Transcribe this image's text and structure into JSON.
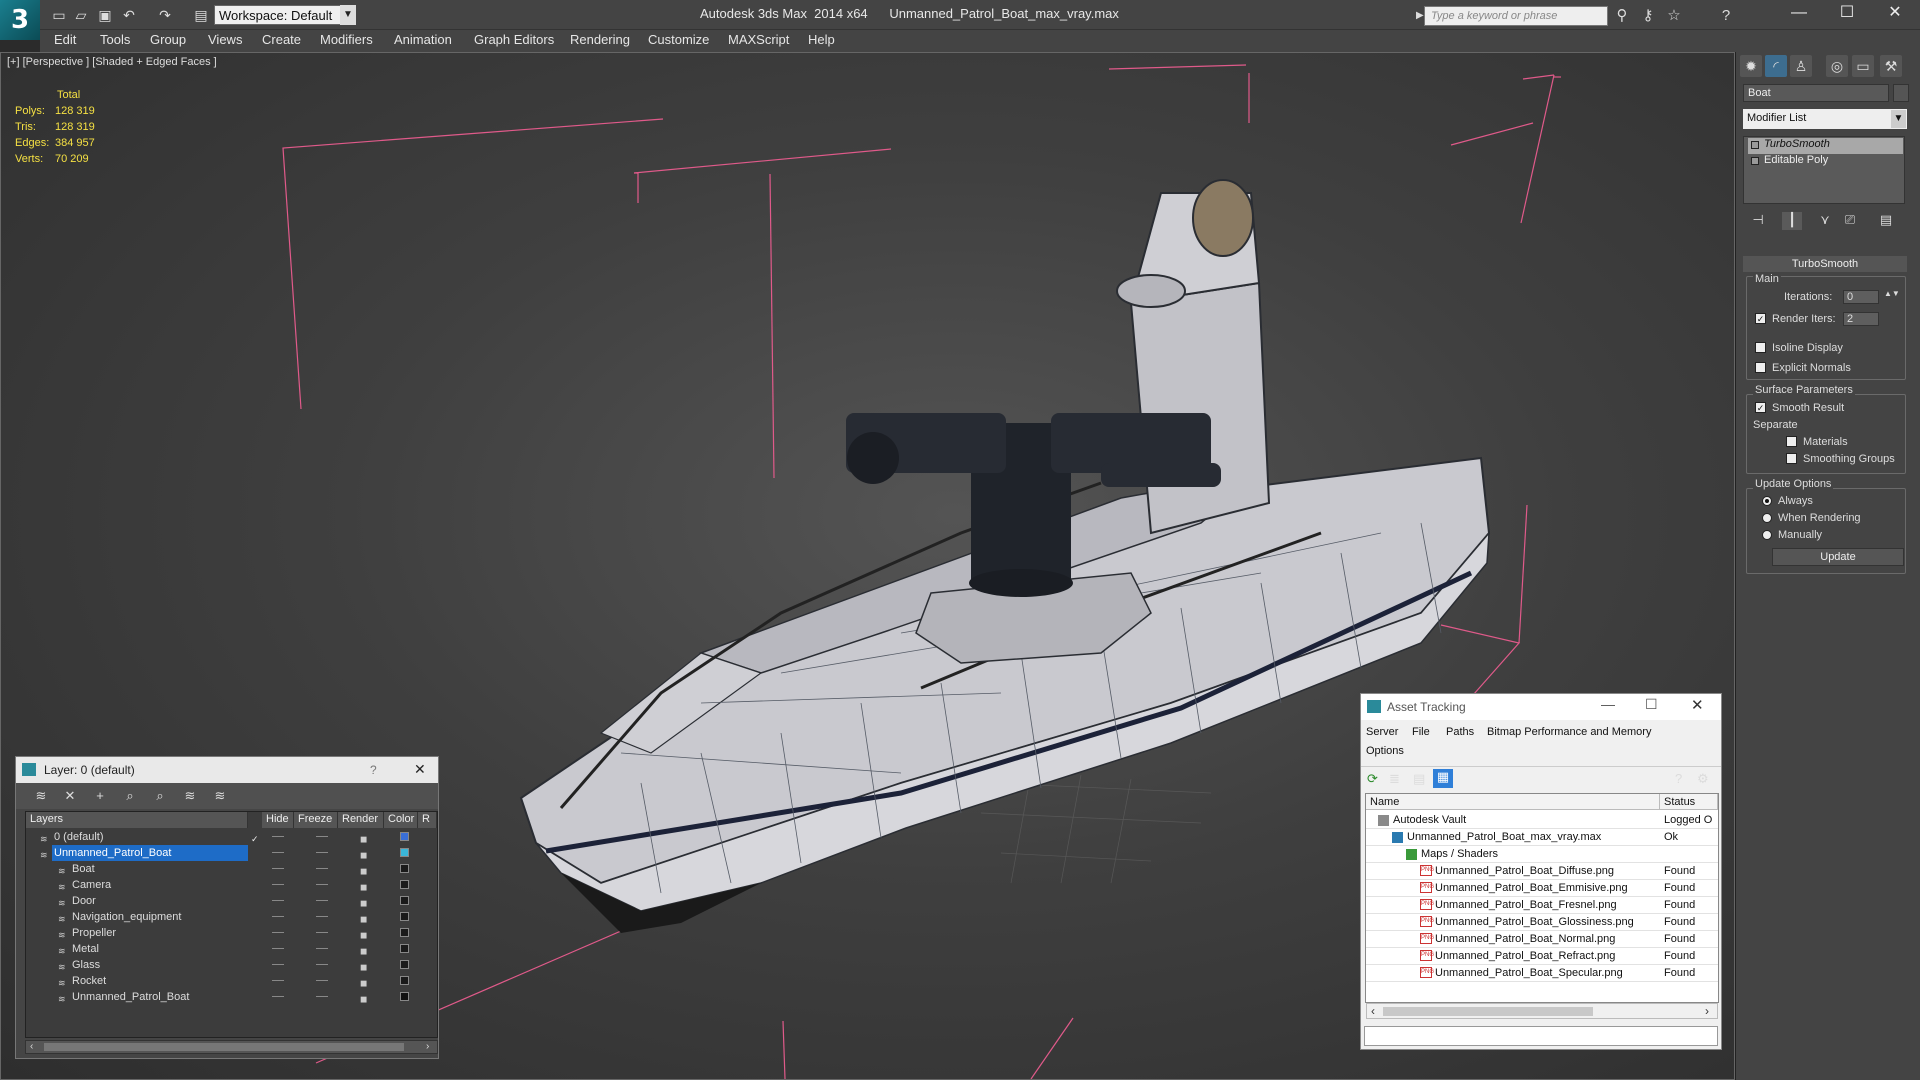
{
  "titlebar": {
    "app_logo": "3",
    "workspace_label": "Workspace: Default",
    "title": "Autodesk 3ds Max  2014 x64      Unmanned_Patrol_Boat_max_vray.max",
    "search_placeholder": "Type a keyword or phrase",
    "icons": [
      "new-file-icon",
      "open-icon",
      "save-icon",
      "undo-icon",
      "redo-icon",
      "project-icon"
    ],
    "right_icons": [
      "binoculars-icon",
      "key-icon",
      "star-icon",
      "help-icon"
    ],
    "window_buttons": {
      "minimize": "—",
      "maximize": "☐",
      "close": "✕"
    }
  },
  "menu": [
    "Edit",
    "Tools",
    "Group",
    "Views",
    "Create",
    "Modifiers",
    "Animation",
    "Graph Editors",
    "Rendering",
    "Customize",
    "MAXScript",
    "Help"
  ],
  "viewport": {
    "label": "[+] [Perspective ] [Shaded + Edged Faces ]",
    "stats_header": "Total",
    "stats": [
      {
        "k": "Polys:",
        "v": "128 319"
      },
      {
        "k": "Tris:",
        "v": "128 319"
      },
      {
        "k": "Edges:",
        "v": "384 957"
      },
      {
        "k": "Verts:",
        "v": "70 209"
      }
    ],
    "colors": {
      "bracket": "#e05a8a",
      "mesh": "#e8e8ec",
      "wire": "#555b66",
      "turret": "#1f232a"
    }
  },
  "command_panel": {
    "object_name": "Boat",
    "modifier_list": "Modifier List",
    "stack": [
      "TurboSmooth",
      "Editable Poly"
    ],
    "rollout_title": "TurboSmooth",
    "main_group": "Main",
    "iterations_label": "Iterations:",
    "iterations_value": "0",
    "render_iters_label": "Render Iters:",
    "render_iters_value": "2",
    "render_iters_checked": true,
    "isoline_label": "Isoline Display",
    "explicit_normals_label": "Explicit Normals",
    "surface_group": "Surface Parameters",
    "smooth_result_label": "Smooth Result",
    "separate_label": "Separate",
    "materials_label": "Materials",
    "smoothing_groups_label": "Smoothing Groups",
    "update_group": "Update Options",
    "update_options": [
      "Always",
      "When Rendering",
      "Manually"
    ],
    "update_selected": "Always",
    "update_button": "Update"
  },
  "layer_window": {
    "title": "Layer: 0 (default)",
    "help": "?",
    "close": "✕",
    "columns": [
      "Layers",
      "Hide",
      "Freeze",
      "Render",
      "Color",
      "R"
    ],
    "rows": [
      {
        "name": "0 (default)",
        "indent": 0,
        "color": "#3a6fd8",
        "selected": false,
        "check": "✓"
      },
      {
        "name": "Unmanned_Patrol_Boat",
        "indent": 0,
        "color": "#3ab6d8",
        "selected": true,
        "check": ""
      },
      {
        "name": "Boat",
        "indent": 1,
        "color": "#1a1a1a",
        "selected": false,
        "check": ""
      },
      {
        "name": "Camera",
        "indent": 1,
        "color": "#1a1a1a",
        "selected": false,
        "check": ""
      },
      {
        "name": "Door",
        "indent": 1,
        "color": "#1a1a1a",
        "selected": false,
        "check": ""
      },
      {
        "name": "Navigation_equipment",
        "indent": 1,
        "color": "#1a1a1a",
        "selected": false,
        "check": ""
      },
      {
        "name": "Propeller",
        "indent": 1,
        "color": "#1a1a1a",
        "selected": false,
        "check": ""
      },
      {
        "name": "Metal",
        "indent": 1,
        "color": "#1a1a1a",
        "selected": false,
        "check": ""
      },
      {
        "name": "Glass",
        "indent": 1,
        "color": "#1a1a1a",
        "selected": false,
        "check": ""
      },
      {
        "name": "Rocket",
        "indent": 1,
        "color": "#1a1a1a",
        "selected": false,
        "check": ""
      },
      {
        "name": "Unmanned_Patrol_Boat",
        "indent": 1,
        "color": "#111111",
        "selected": false,
        "check": ""
      }
    ]
  },
  "asset_tracking": {
    "title": "Asset Tracking",
    "menu": [
      "Server",
      "File",
      "Paths",
      "Bitmap Performance and Memory",
      "Options"
    ],
    "columns": [
      "Name",
      "Status"
    ],
    "rows": [
      {
        "name": "Autodesk Vault",
        "status": "Logged O",
        "level": 0,
        "type": "vault"
      },
      {
        "name": "Unmanned_Patrol_Boat_max_vray.max",
        "status": "Ok",
        "level": 1,
        "type": "max"
      },
      {
        "name": "Maps / Shaders",
        "status": "",
        "level": 2,
        "type": "folder"
      },
      {
        "name": "Unmanned_Patrol_Boat_Diffuse.png",
        "status": "Found",
        "level": 3,
        "type": "png"
      },
      {
        "name": "Unmanned_Patrol_Boat_Emmisive.png",
        "status": "Found",
        "level": 3,
        "type": "png"
      },
      {
        "name": "Unmanned_Patrol_Boat_Fresnel.png",
        "status": "Found",
        "level": 3,
        "type": "png"
      },
      {
        "name": "Unmanned_Patrol_Boat_Glossiness.png",
        "status": "Found",
        "level": 3,
        "type": "png"
      },
      {
        "name": "Unmanned_Patrol_Boat_Normal.png",
        "status": "Found",
        "level": 3,
        "type": "png"
      },
      {
        "name": "Unmanned_Patrol_Boat_Refract.png",
        "status": "Found",
        "level": 3,
        "type": "png"
      },
      {
        "name": "Unmanned_Patrol_Boat_Specular.png",
        "status": "Found",
        "level": 3,
        "type": "png"
      }
    ],
    "png_badge": "PNG"
  }
}
